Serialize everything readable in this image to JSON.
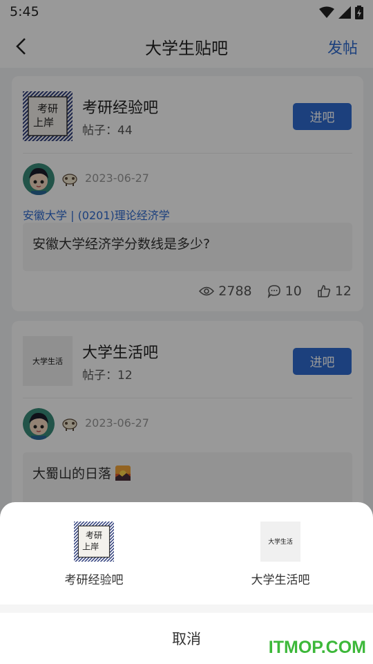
{
  "status_bar": {
    "time": "5:45"
  },
  "navbar": {
    "title": "大学生贴吧",
    "post_label": "发帖"
  },
  "cards": [
    {
      "forum_name": "考研经验吧",
      "post_count": "帖子：44",
      "thumb_text": [
        "考研",
        "上岸"
      ],
      "enter_label": "进吧",
      "date": "2023-06-27",
      "tag": "安徽大学 | (0201)理论经济学",
      "text": "安徽大学经济学分数线是多少?",
      "views": "2788",
      "comments": "10",
      "likes": "12"
    },
    {
      "forum_name": "大学生活吧",
      "post_count": "帖子：12",
      "thumb_text": "大学生活",
      "enter_label": "进吧",
      "date": "2023-06-27",
      "text": "大蜀山的日落"
    }
  ],
  "sheet": {
    "items": [
      {
        "label": "考研经验吧",
        "thumb_text": [
          "考研",
          "上岸"
        ]
      },
      {
        "label": "大学生活吧",
        "thumb_text": "大学生活"
      }
    ],
    "cancel_label": "取消"
  },
  "watermark": "ITMOP.COM",
  "colors": {
    "accent": "#2f6bd0",
    "watermark": "#3db83a"
  }
}
